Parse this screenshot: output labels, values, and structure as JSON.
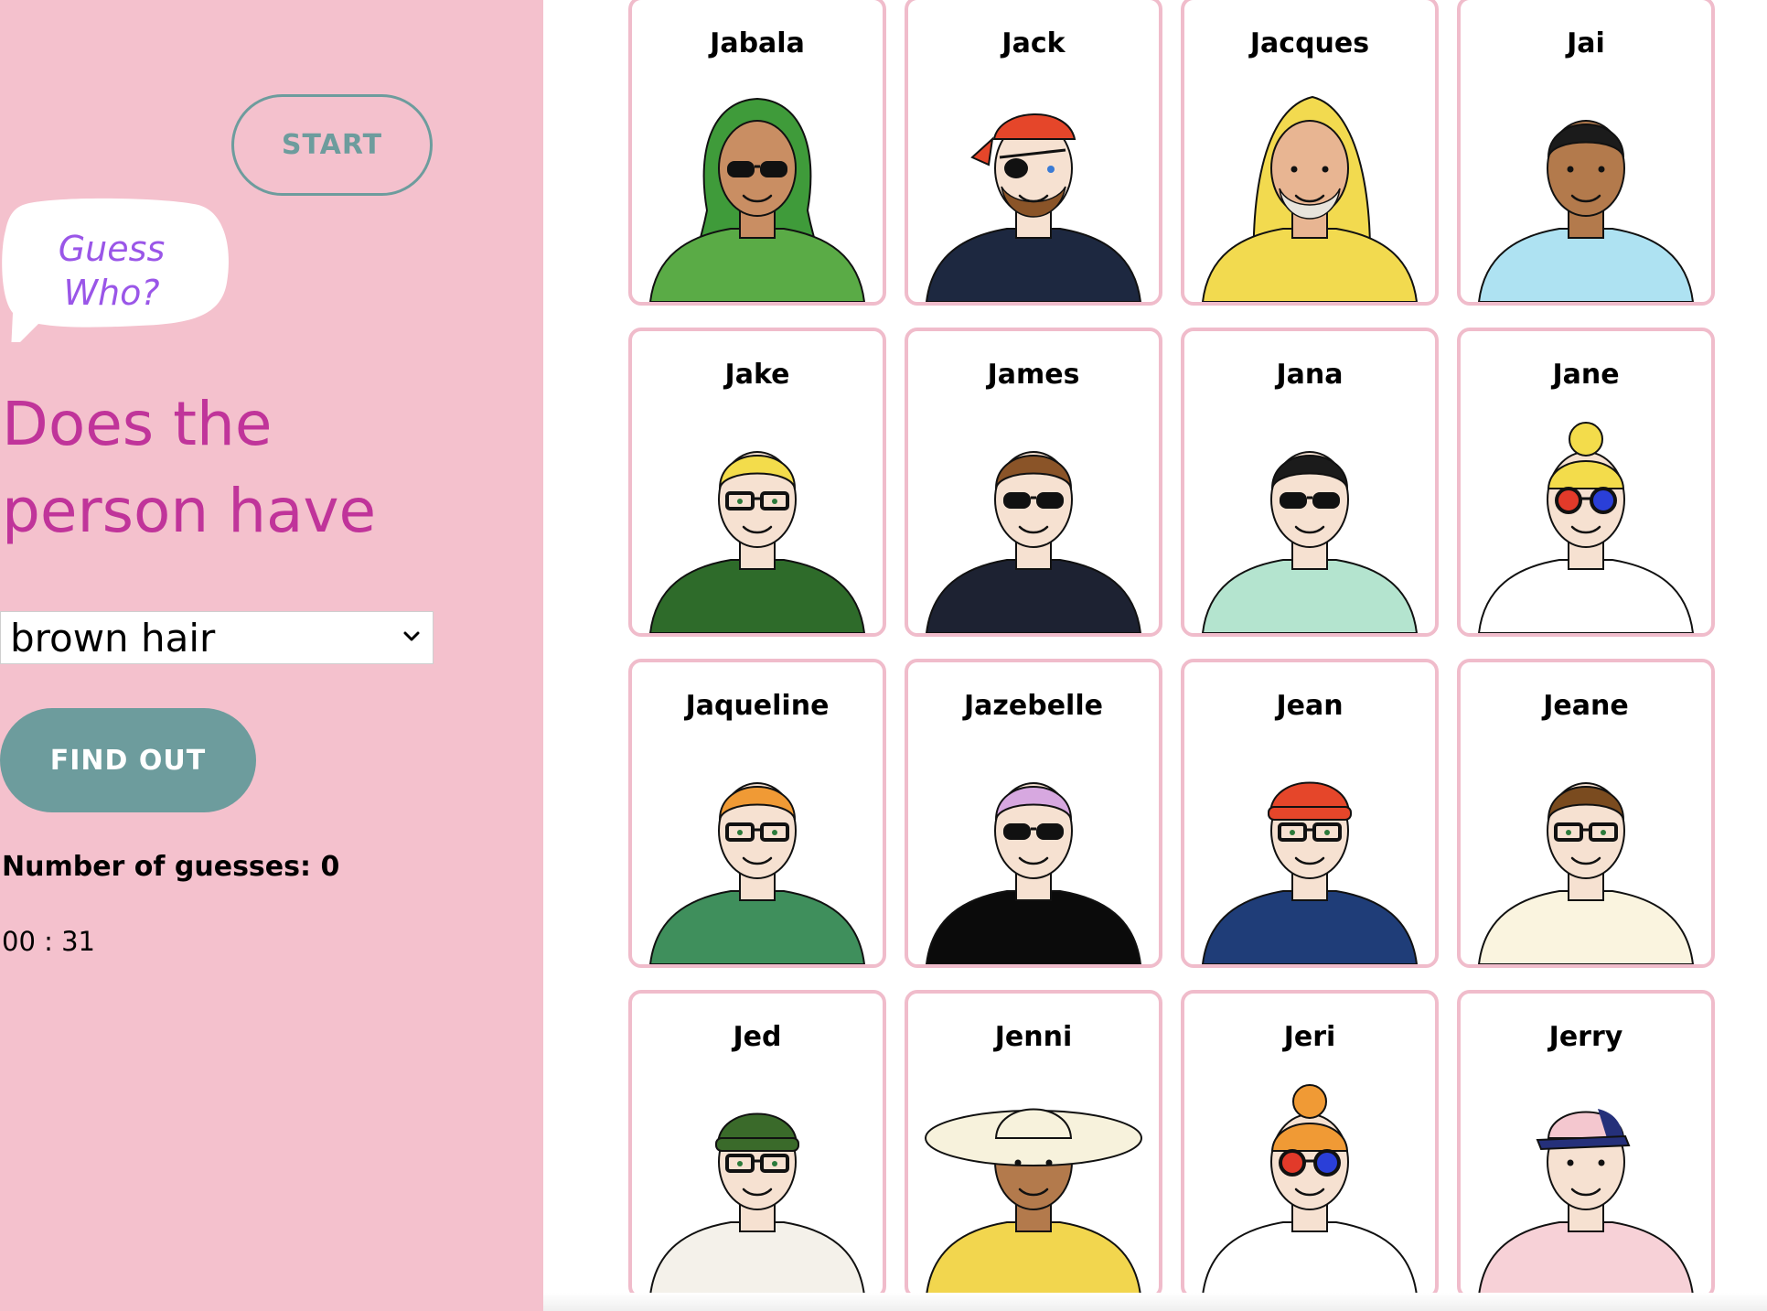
{
  "sidebar": {
    "start_label": "START",
    "bubble": {
      "line1": "Guess",
      "line2": "Who?"
    },
    "question": {
      "line1": "Does the",
      "line2": "person have"
    },
    "select": {
      "selected": "brown hair"
    },
    "find_label": "FIND OUT",
    "guesses": {
      "label": "Number of guesses:",
      "value": "0"
    },
    "timer": "00 : 31"
  },
  "colors": {
    "sidebar_bg": "#f4c1cd",
    "accent_teal": "#6d9c9d",
    "question_magenta": "#c0349a",
    "bubble_purple": "#9a56e8",
    "card_border": "#f0bccb"
  },
  "cards": [
    {
      "name": "Jabala",
      "skin": "#c98e63",
      "hair": "#3f9b3a",
      "shirt": "#5aab46",
      "headwear": "hijab",
      "eyewear": "sunglasses"
    },
    {
      "name": "Jack",
      "skin": "#f6e1d1",
      "hair": "#8a5428",
      "shirt": "#1d2840",
      "headwear": "bandana",
      "eyewear": "eyepatch"
    },
    {
      "name": "Jacques",
      "skin": "#e8b592",
      "hair": "#e8e4dc",
      "shirt": "#f2da4f",
      "headwear": "hood",
      "eyewear": "none"
    },
    {
      "name": "Jai",
      "skin": "#b37a4c",
      "hair": "#1b1b1b",
      "shirt": "#aee2f2",
      "headwear": "none",
      "eyewear": "none"
    },
    {
      "name": "Jake",
      "skin": "#f6e1d1",
      "hair": "#f3dc4b",
      "shirt": "#2e6b2a",
      "headwear": "none",
      "eyewear": "glasses"
    },
    {
      "name": "James",
      "skin": "#f6e1d1",
      "hair": "#8a5428",
      "shirt": "#1d2232",
      "headwear": "none",
      "eyewear": "sunglasses"
    },
    {
      "name": "Jana",
      "skin": "#f6e1d1",
      "hair": "#1b1b1b",
      "shirt": "#b4e4cf",
      "headwear": "none",
      "eyewear": "sunglasses"
    },
    {
      "name": "Jane",
      "skin": "#f6e1d1",
      "hair": "#f3dc4b",
      "shirt": "#ffffff",
      "headwear": "bun",
      "eyewear": "round"
    },
    {
      "name": "Jaqueline",
      "skin": "#f6e1d1",
      "hair": "#f09a35",
      "shirt": "#3f8f5c",
      "headwear": "none",
      "eyewear": "glasses"
    },
    {
      "name": "Jazebelle",
      "skin": "#f6e1d1",
      "hair": "#d7a8e0",
      "shirt": "#0b0b0b",
      "headwear": "none",
      "eyewear": "sunglasses"
    },
    {
      "name": "Jean",
      "skin": "#f6e1d1",
      "hair": "#e5462a",
      "shirt": "#1f3d78",
      "headwear": "beanie",
      "eyewear": "glasses"
    },
    {
      "name": "Jeane",
      "skin": "#f6e1d1",
      "hair": "#7a4b1f",
      "shirt": "#faf4df",
      "headwear": "none",
      "eyewear": "glasses"
    },
    {
      "name": "Jed",
      "skin": "#f6e1d1",
      "hair": "#3a6a2a",
      "shirt": "#f4f1ea",
      "headwear": "beanie",
      "eyewear": "glasses"
    },
    {
      "name": "Jenni",
      "skin": "#b37a4c",
      "hair": "#f7f2dc",
      "shirt": "#f2d64e",
      "headwear": "sunhat",
      "eyewear": "none"
    },
    {
      "name": "Jeri",
      "skin": "#f6e1d1",
      "hair": "#f09a35",
      "shirt": "#ffffff",
      "headwear": "bun",
      "eyewear": "round"
    },
    {
      "name": "Jerry",
      "skin": "#f6e1d1",
      "hair": "#f4c7cf",
      "shirt": "#f7d1d7",
      "headwear": "cap",
      "eyewear": "none"
    }
  ]
}
